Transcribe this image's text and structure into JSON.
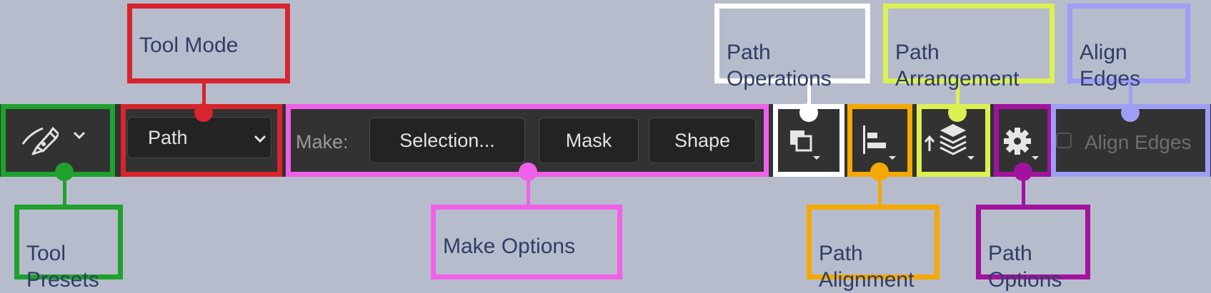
{
  "toolbar": {
    "tool_mode_value": "Path",
    "make_label": "Make:",
    "make_buttons": [
      "Selection...",
      "Mask",
      "Shape"
    ],
    "align_edges_label": "Align Edges"
  },
  "callouts": {
    "tool_presets": "Tool\nPresets",
    "tool_mode": "Tool Mode",
    "make_options": "Make Options",
    "path_operations": "Path\nOperations",
    "path_alignment": "Path\nAlignment",
    "path_arrangement": "Path\nArrangement",
    "path_options": "Path\nOptions",
    "align_edges": "Align\nEdges"
  },
  "icons": [
    "pen-icon",
    "chevron-down-icon",
    "path-operations-icon",
    "path-alignment-icon",
    "path-arrangement-icon",
    "gear-icon",
    "checkbox"
  ],
  "colors": {
    "tool_presets": "#1fa12e",
    "tool_mode": "#d8242c",
    "make_options": "#f060e8",
    "path_operations": "#ffffff",
    "path_alignment": "#f5a800",
    "path_arrangement": "#dcf052",
    "path_options": "#a3129e",
    "align_edges": "#9e9ef5"
  }
}
